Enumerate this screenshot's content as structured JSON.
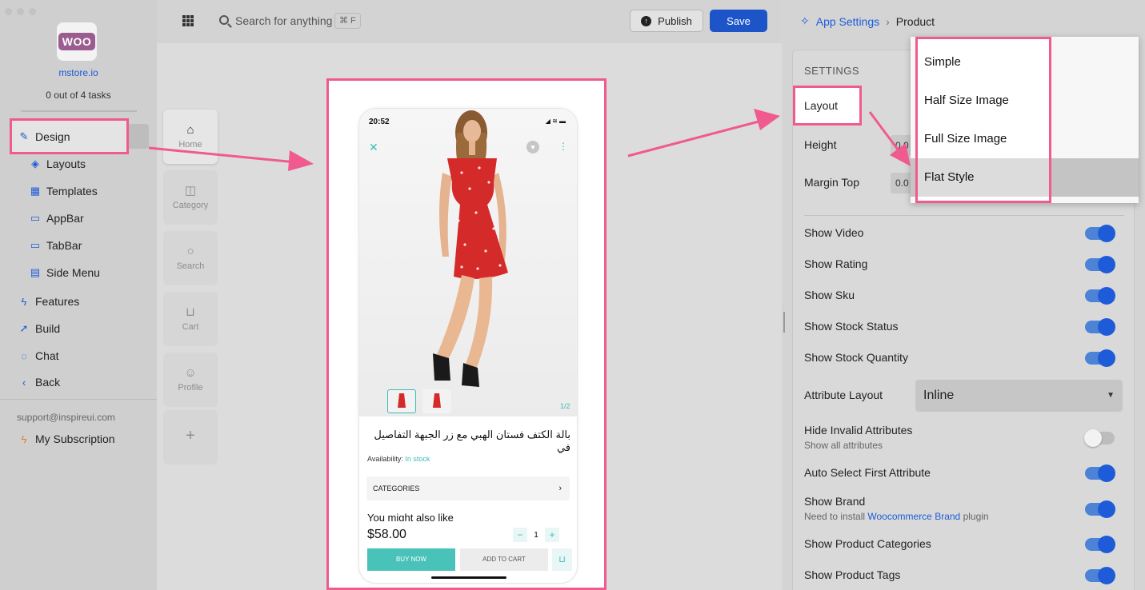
{
  "sidebar": {
    "logo_text": "WOO",
    "site": "mstore.io",
    "tasks": "0 out of 4 tasks",
    "items": [
      {
        "label": "Design",
        "icon": "brush-icon"
      },
      {
        "label": "Layouts",
        "icon": "layers-icon"
      },
      {
        "label": "Templates",
        "icon": "grid-icon"
      },
      {
        "label": "AppBar",
        "icon": "appbar-icon"
      },
      {
        "label": "TabBar",
        "icon": "tabbar-icon"
      },
      {
        "label": "Side Menu",
        "icon": "sidemenu-icon"
      },
      {
        "label": "Features",
        "icon": "bolt-icon"
      },
      {
        "label": "Build",
        "icon": "rocket-icon"
      },
      {
        "label": "Chat",
        "icon": "chat-icon"
      },
      {
        "label": "Back",
        "icon": "chevron-left-icon"
      }
    ],
    "support_email": "support@inspireui.com",
    "subscription": "My Subscription"
  },
  "topbar": {
    "search_placeholder": "Search for anything",
    "shortcut": "⌘ F",
    "publish_label": "Publish",
    "save_label": "Save"
  },
  "rail": [
    {
      "label": "Home",
      "icon": "home-icon"
    },
    {
      "label": "Category",
      "icon": "category-icon"
    },
    {
      "label": "Search",
      "icon": "search-icon"
    },
    {
      "label": "Cart",
      "icon": "cart-icon"
    },
    {
      "label": "Profile",
      "icon": "profile-icon"
    },
    {
      "label": "",
      "icon": "plus-icon"
    }
  ],
  "preview": {
    "time": "20:52",
    "pager": "1/2",
    "title": "بالة الكتف فستان الهبي مع زر الجبهة التفاصيل في",
    "availability_label": "Availability:",
    "availability_value": "In stock",
    "categories_label": "CATEGORIES",
    "also_like": "You might also like",
    "price": "$58.00",
    "qty": "1",
    "buy_now": "BUY NOW",
    "add_to_cart": "ADD TO CART"
  },
  "breadcrumb": {
    "parent": "App Settings",
    "current": "Product"
  },
  "settings": {
    "title": "SETTINGS",
    "layout_label": "Layout",
    "height_label": "Height",
    "height_value": "0.0",
    "margin_top_label": "Margin Top",
    "margin_top_value": "0.0",
    "toggles": [
      {
        "label": "Show Video",
        "on": true
      },
      {
        "label": "Show Rating",
        "on": true
      },
      {
        "label": "Show Sku",
        "on": true
      },
      {
        "label": "Show Stock Status",
        "on": true
      },
      {
        "label": "Show Stock Quantity",
        "on": true
      }
    ],
    "attribute_layout_label": "Attribute Layout",
    "attribute_layout_value": "Inline",
    "hide_invalid_label": "Hide Invalid Attributes",
    "hide_invalid_sub": "Show all attributes",
    "auto_select_label": "Auto Select First Attribute",
    "show_brand_label": "Show Brand",
    "show_brand_sub_pre": "Need to install",
    "show_brand_sub_link": "Woocommerce Brand",
    "show_brand_sub_post": "plugin",
    "show_categories_label": "Show Product Categories",
    "show_tags_label": "Show Product Tags"
  },
  "layout_dropdown": {
    "options": [
      "Simple",
      "Half Size Image",
      "Full Size Image",
      "Flat Style"
    ],
    "selected": "Flat Style"
  },
  "colors": {
    "accent": "#1d5bd8",
    "highlight": "#f05a8f",
    "teal": "#3bbdb5"
  }
}
